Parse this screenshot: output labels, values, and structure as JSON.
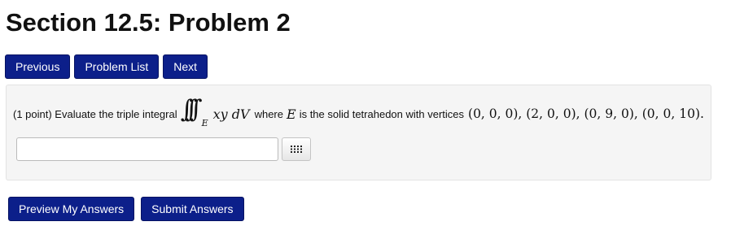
{
  "page": {
    "title": "Section 12.5: Problem 2"
  },
  "nav": {
    "previous": "Previous",
    "problem_list": "Problem List",
    "next": "Next"
  },
  "problem": {
    "points": "(1 point) Evaluate the triple integral",
    "integrand": "xy dV",
    "region_sub": "E",
    "where_text": "where",
    "region": "E",
    "rest_text": "is the solid tetrahedon with vertices",
    "vertices": "(0, 0, 0), (2, 0, 0), (0, 9, 0), (0, 0, 10)",
    "end": "."
  },
  "answer": {
    "value": "",
    "placeholder": ""
  },
  "actions": {
    "preview": "Preview My Answers",
    "submit": "Submit Answers"
  },
  "colors": {
    "button_bg": "#0c1f8a",
    "box_bg": "#f5f5f5"
  }
}
